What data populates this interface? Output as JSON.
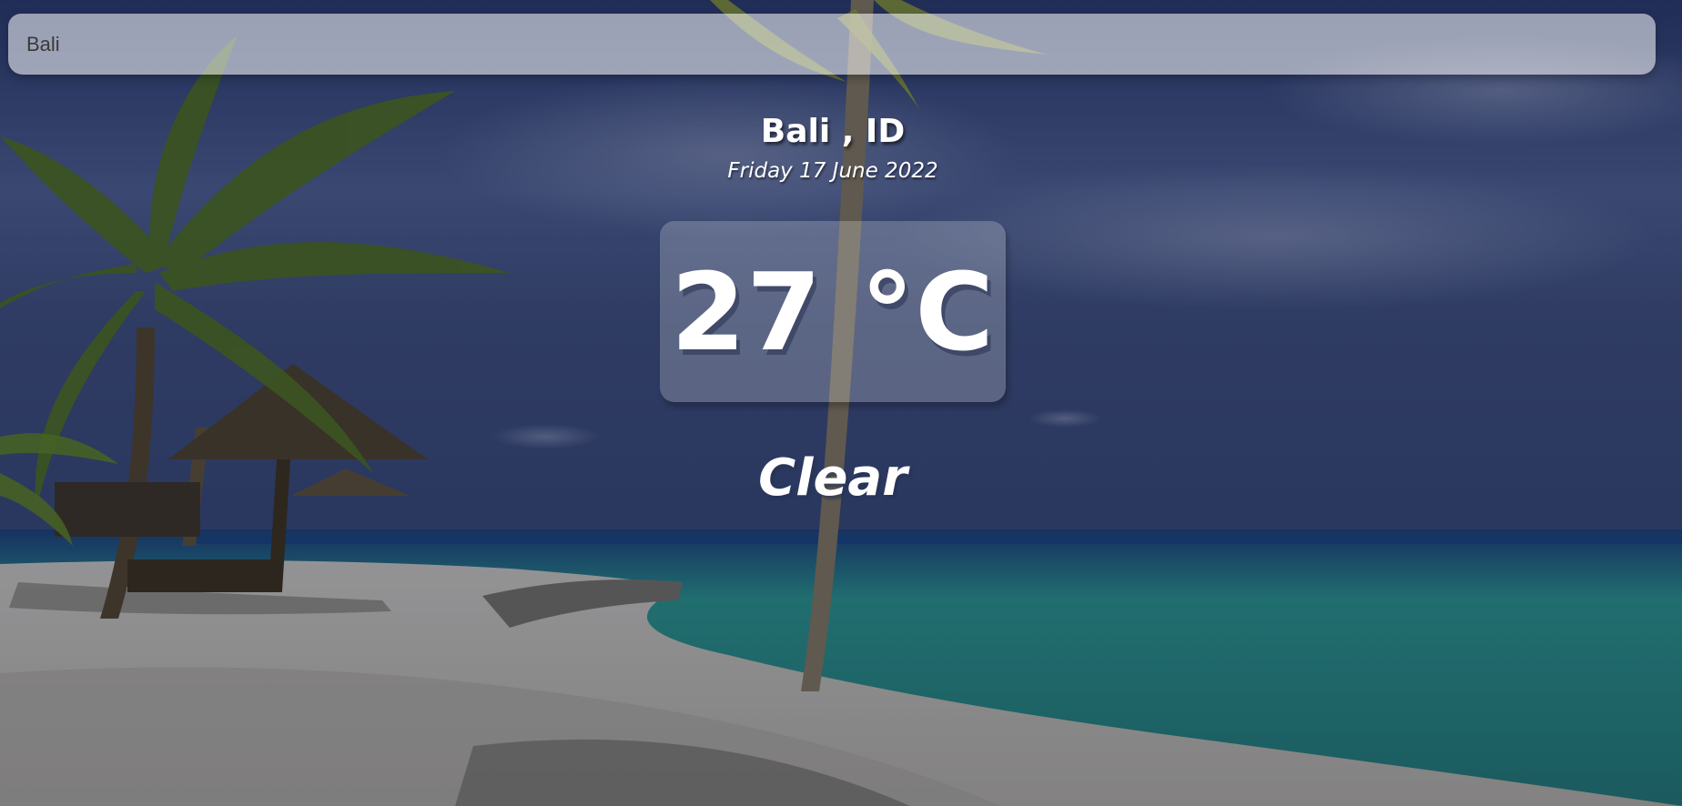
{
  "search": {
    "value": "Bali",
    "placeholder": ""
  },
  "weather": {
    "location": "Bali , ID",
    "date": "Friday 17 June 2022",
    "temperature": "27 °C",
    "condition": "Clear"
  }
}
